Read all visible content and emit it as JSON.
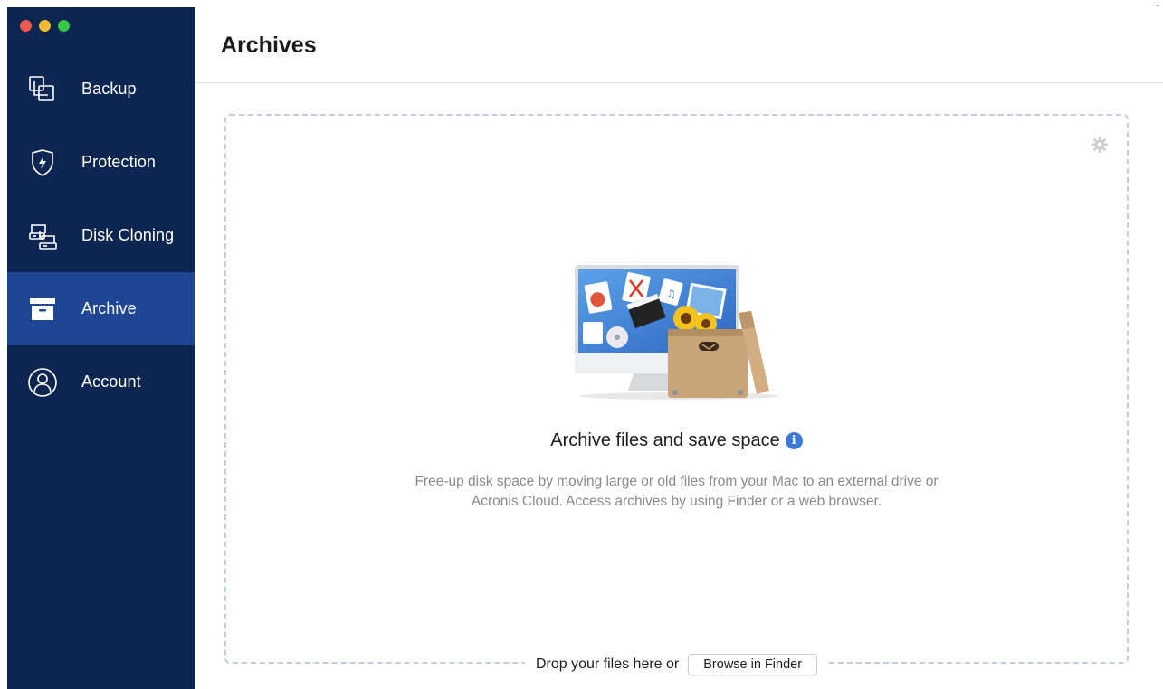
{
  "window": {
    "traffic_lights": [
      "close",
      "minimize",
      "zoom"
    ]
  },
  "sidebar": {
    "items": [
      {
        "label": "Backup",
        "icon": "backup-icon",
        "active": false
      },
      {
        "label": "Protection",
        "icon": "shield-bolt-icon",
        "active": false
      },
      {
        "label": "Disk Cloning",
        "icon": "disk-cloning-icon",
        "active": false
      },
      {
        "label": "Archive",
        "icon": "archive-box-icon",
        "active": true
      },
      {
        "label": "Account",
        "icon": "user-icon",
        "active": false
      }
    ],
    "colors": {
      "background": "#0d2651",
      "active": "#1e4694"
    }
  },
  "main": {
    "title": "Archives",
    "corner_mark": "ˇ",
    "dropzone": {
      "heading": "Archive files and save space",
      "info_icon_glyph": "i",
      "description_line1": "Free-up disk space by moving large or old files from your Mac to an external drive or",
      "description_line2": "Acronis Cloud. Access archives by using Finder or a web browser.",
      "drop_text": "Drop your files here or",
      "browse_button": "Browse in Finder",
      "settings_icon": "gear-icon"
    }
  }
}
